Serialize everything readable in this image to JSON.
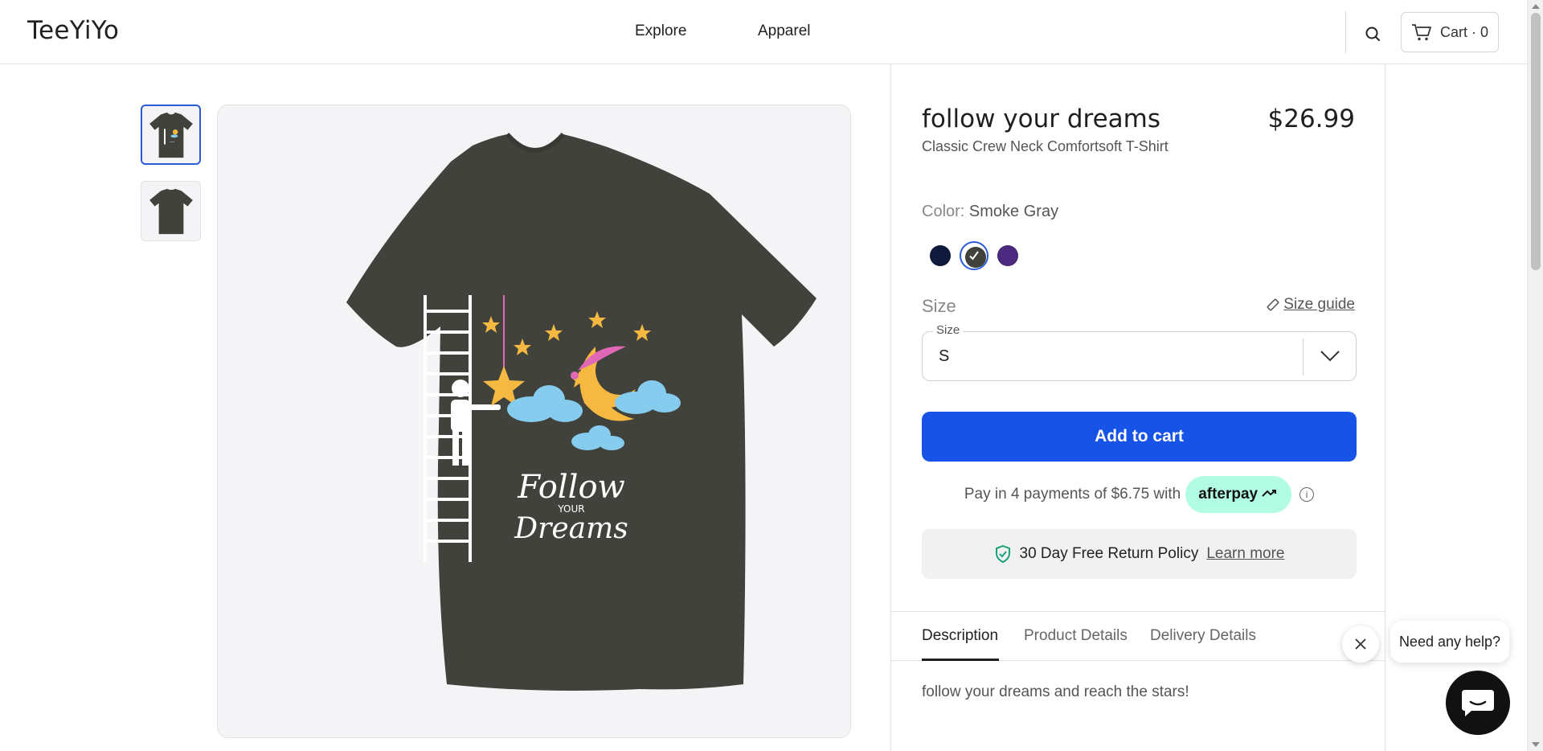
{
  "header": {
    "logo": "TeeYiYo",
    "nav": [
      "Explore",
      "Apparel"
    ],
    "cart_label": "Cart · 0"
  },
  "gallery": {
    "thumbnails": [
      "front",
      "back"
    ],
    "design_text": [
      "Follow",
      "YOUR",
      "Dreams"
    ]
  },
  "product": {
    "title": "follow your dreams",
    "subtitle": "Classic Crew Neck Comfortsoft T-Shirt",
    "price": "$26.99",
    "color_label": "Color:",
    "color_value": "Smoke Gray",
    "swatches": [
      {
        "name": "Navy",
        "color": "#0f1a3c"
      },
      {
        "name": "Smoke Gray",
        "color": "#41423b",
        "selected": true
      },
      {
        "name": "Purple",
        "color": "#4b2a80"
      }
    ],
    "size_label": "Size",
    "size_guide": "Size guide",
    "size_select_legend": "Size",
    "size_value": "S",
    "add_to_cart": "Add to cart",
    "afterpay_text": "Pay in 4 payments of $6.75 with",
    "afterpay_brand": "afterpay",
    "return_policy": "30 Day Free Return Policy",
    "return_link": "Learn more"
  },
  "tabs": [
    "Description",
    "Product Details",
    "Delivery Details"
  ],
  "description": "follow your dreams and reach the stars!",
  "help": {
    "bubble": "Need any help?"
  },
  "colors": {
    "accent": "#1753e6",
    "afterpay": "#b2fce4",
    "shirt": "#41423b"
  }
}
